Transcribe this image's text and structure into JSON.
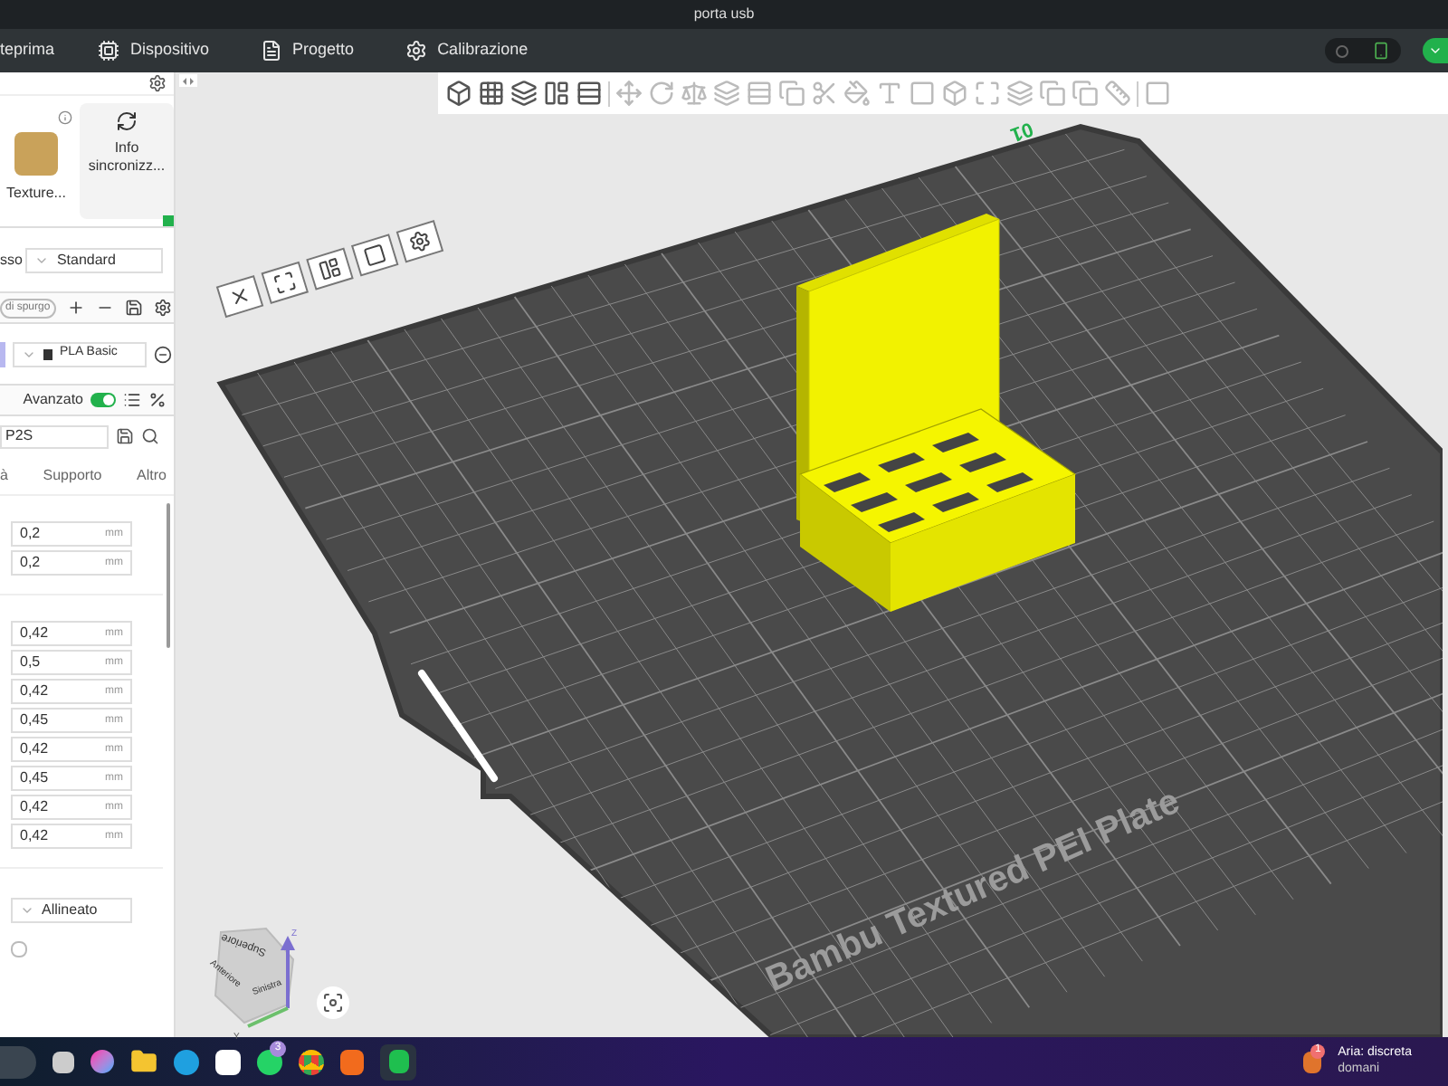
{
  "window": {
    "title": "porta usb"
  },
  "menu_tabs": [
    {
      "label": "teprima",
      "kind": "plain"
    },
    {
      "label": "Dispositivo",
      "kind": "device"
    },
    {
      "label": "Progetto",
      "kind": "project"
    },
    {
      "label": "Calibrazione",
      "kind": "calibrate"
    }
  ],
  "left_panel": {
    "plate_card": {
      "label": "Texture..."
    },
    "sync_card": {
      "label": "Info sincronizz..."
    },
    "process": {
      "label": "sso",
      "preset": "Standard"
    },
    "filament_header": {
      "pill": "di spurgo"
    },
    "filament": {
      "name": "PLA Basic"
    },
    "advanced": {
      "label": "Avanzato",
      "on": true
    },
    "printer_preset": {
      "value": "P2S"
    },
    "tabs": [
      {
        "label": "à"
      },
      {
        "label": "Supporto"
      },
      {
        "label": "Altro"
      }
    ],
    "field_groups": [
      {
        "fields": [
          {
            "value": "0,2",
            "unit": "mm"
          },
          {
            "value": "0,2",
            "unit": "mm"
          }
        ]
      },
      {
        "fields": [
          {
            "value": "0,42",
            "unit": "mm"
          },
          {
            "value": "0,5",
            "unit": "mm"
          },
          {
            "value": "0,42",
            "unit": "mm"
          },
          {
            "value": "0,45",
            "unit": "mm"
          },
          {
            "value": "0,42",
            "unit": "mm"
          },
          {
            "value": "0,45",
            "unit": "mm"
          },
          {
            "value": "0,42",
            "unit": "mm"
          },
          {
            "value": "0,42",
            "unit": "mm"
          }
        ]
      }
    ],
    "seam": {
      "value": "Allineato"
    },
    "option": {
      "checked": false
    }
  },
  "canvas": {
    "plate_number": "01",
    "plate_label": "Bambu Textured PEI Plate",
    "view_cube": {
      "top": "Superiore",
      "front": "Anteriore",
      "left": "Sinistra",
      "z_axis": "Z",
      "y_axis": "Y"
    }
  },
  "taskbar": {
    "whatsapp_badge": "3",
    "weather_badge": "1",
    "weather": "Aria: discreta",
    "weather_sub": "domani"
  }
}
